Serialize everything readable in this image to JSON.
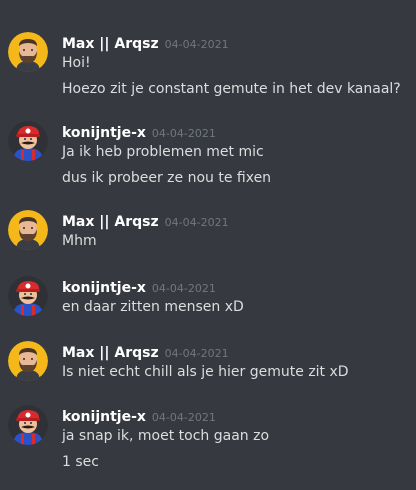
{
  "colors": {
    "background": "#36393f",
    "username": "#ffffff",
    "timestamp": "#72767d",
    "message_text": "#dcddde"
  },
  "messages": [
    {
      "author": "Max || Arqsz",
      "avatar": "bearded-man-avatar",
      "timestamp": "04-04-2021",
      "lines": [
        "Hoi!",
        "Hoezo zit je constant gemute in het dev kanaal?"
      ]
    },
    {
      "author": "konijntje-x",
      "avatar": "mario-avatar",
      "timestamp": "04-04-2021",
      "lines": [
        "Ja ik heb problemen met mic",
        "dus ik probeer ze nou te fixen"
      ]
    },
    {
      "author": "Max || Arqsz",
      "avatar": "bearded-man-avatar",
      "timestamp": "04-04-2021",
      "lines": [
        "Mhm"
      ]
    },
    {
      "author": "konijntje-x",
      "avatar": "mario-avatar",
      "timestamp": "04-04-2021",
      "lines": [
        "en daar zitten mensen xD"
      ]
    },
    {
      "author": "Max || Arqsz",
      "avatar": "bearded-man-avatar",
      "timestamp": "04-04-2021",
      "lines": [
        "Is niet echt chill als je hier gemute zit xD"
      ]
    },
    {
      "author": "konijntje-x",
      "avatar": "mario-avatar",
      "timestamp": "04-04-2021",
      "lines": [
        "ja snap ik, moet toch gaan zo",
        "1 sec"
      ]
    }
  ]
}
